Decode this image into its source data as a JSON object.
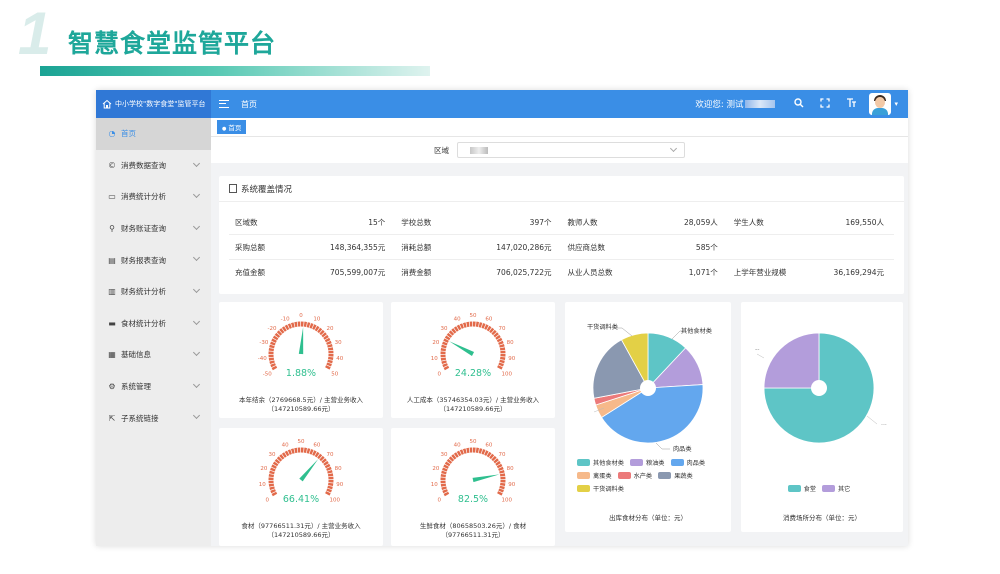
{
  "slide": {
    "number": "1",
    "title": "智慧食堂监管平台"
  },
  "app": {
    "brand": "中小学校\"数字食堂\"监管平台",
    "top_home": "首页",
    "welcome": "欢迎您: 测试",
    "icons": {
      "search": "search-icon",
      "fullscreen": "fullscreen-icon",
      "font_size": "font-size-icon"
    }
  },
  "sidebar": {
    "items": [
      {
        "label": "首页",
        "icon": "dashboard-icon",
        "active": true
      },
      {
        "label": "消费数据查询",
        "icon": "copyright-icon"
      },
      {
        "label": "消费统计分析",
        "icon": "monitor-icon"
      },
      {
        "label": "财务账证查询",
        "icon": "search-icon"
      },
      {
        "label": "财务报表查询",
        "icon": "document-icon"
      },
      {
        "label": "财务统计分析",
        "icon": "bar-chart-icon"
      },
      {
        "label": "食材统计分析",
        "icon": "lock-icon"
      },
      {
        "label": "基础信息",
        "icon": "grid-icon"
      },
      {
        "label": "系统管理",
        "icon": "gear-icon"
      },
      {
        "label": "子系统链接",
        "icon": "external-link-icon"
      }
    ]
  },
  "tabs": {
    "active": "首页"
  },
  "filter": {
    "label": "区域"
  },
  "coverage": {
    "title": "系统覆盖情况",
    "rows": [
      [
        {
          "k": "区域数",
          "v": "15个"
        },
        {
          "k": "学校总数",
          "v": "397个"
        },
        {
          "k": "教师人数",
          "v": "28,059人"
        },
        {
          "k": "学生人数",
          "v": "169,550人"
        }
      ],
      [
        {
          "k": "采购总额",
          "v": "148,364,355元"
        },
        {
          "k": "消耗总额",
          "v": "147,020,286元"
        },
        {
          "k": "供应商总数",
          "v": "585个"
        },
        {
          "k": "",
          "v": ""
        }
      ],
      [
        {
          "k": "充值金额",
          "v": "705,599,007元"
        },
        {
          "k": "消费金额",
          "v": "706,025,722元"
        },
        {
          "k": "从业人员总数",
          "v": "1,071个"
        },
        {
          "k": "上学年营业规模",
          "v": "36,169,294元"
        }
      ]
    ]
  },
  "gauges": [
    {
      "value": 1.88,
      "display": "1.88%",
      "min": -50,
      "max": 50,
      "ticks": [
        "-50",
        "-40",
        "-30",
        "-20",
        "-10",
        "0",
        "10",
        "20",
        "30",
        "40",
        "50"
      ],
      "color": "#e26a4a",
      "caption1": "本年结余（2769668.5元）/ 主营业务收入",
      "caption2": "（147210589.66元）"
    },
    {
      "value": 24.28,
      "display": "24.28%",
      "min": 0,
      "max": 100,
      "ticks": [
        "0",
        "10",
        "20",
        "30",
        "40",
        "50",
        "60",
        "70",
        "80",
        "90",
        "100"
      ],
      "color": "#e26a4a",
      "caption1": "人工成本（35746354.03元）/ 主营业务收入",
      "caption2": "（147210589.66元）"
    },
    {
      "value": 66.41,
      "display": "66.41%",
      "min": 0,
      "max": 100,
      "ticks": [
        "0",
        "10",
        "20",
        "30",
        "40",
        "50",
        "60",
        "70",
        "80",
        "90",
        "100"
      ],
      "color": "#e26a4a",
      "caption1": "食材（97766511.31元）/ 主营业务收入",
      "caption2": "（147210589.66元）"
    },
    {
      "value": 82.5,
      "display": "82.5%",
      "min": 0,
      "max": 100,
      "ticks": [
        "0",
        "10",
        "20",
        "30",
        "40",
        "50",
        "60",
        "70",
        "80",
        "90",
        "100"
      ],
      "color": "#e26a4a",
      "caption1": "生鲜食材（80658503.26元）/ 食材",
      "caption2": "（97766511.31元）"
    }
  ],
  "colors": {
    "accent": "#3a8ee6",
    "gauge_value": "#2fbf8f",
    "gauge_arc": "#e26a4a"
  },
  "chart_data": [
    {
      "type": "pie",
      "title": "出库食材分布（单位：元）",
      "series": [
        {
          "name": "其他食材类",
          "value": 12,
          "color": "#5ec5c6"
        },
        {
          "name": "粮油类",
          "value": 12,
          "color": "#b39ddb"
        },
        {
          "name": "肉品类",
          "value": 42,
          "color": "#63a7ee"
        },
        {
          "name": "禽蛋类",
          "value": 4,
          "color": "#f6b98a"
        },
        {
          "name": "水产类",
          "value": 2,
          "color": "#ec7a7a"
        },
        {
          "name": "果蔬类",
          "value": 20,
          "color": "#8a98b0"
        },
        {
          "name": "干货调料类",
          "value": 8,
          "color": "#e3d046"
        }
      ],
      "outer_labels": {
        "top_left": "干货调料类",
        "top_right": "其他食材类",
        "bottom": "肉品类"
      }
    },
    {
      "type": "pie",
      "title": "消费场所分布（单位：元）",
      "series": [
        {
          "name": "食堂",
          "value": 75,
          "color": "#5ec5c6"
        },
        {
          "name": "其它",
          "value": 25,
          "color": "#b39ddb"
        }
      ],
      "outer_labels": {
        "left": "--",
        "right": "..."
      }
    }
  ]
}
